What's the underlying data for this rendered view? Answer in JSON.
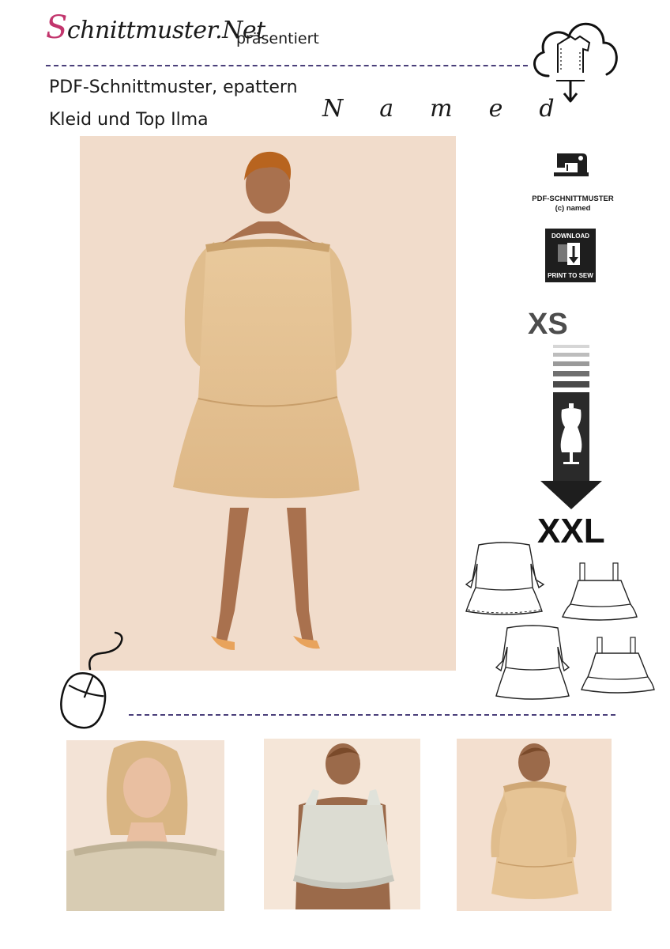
{
  "header": {
    "logo_text": "chnittmuster.Net",
    "logo_initial": "S",
    "presents": "präsentiert"
  },
  "title": {
    "line1": "PDF-Schnittmuster, epattern",
    "line2": "Kleid und Top Ilma",
    "brand": "Named"
  },
  "sidebar": {
    "pattern_label_line1": "PDF-SCHNITTMUSTER",
    "pattern_label_line2": "(c) named",
    "download_top": "DOWNLOAD",
    "download_bottom": "PRINT TO SEW",
    "size_min": "XS",
    "size_max": "XXL"
  },
  "icons": {
    "cloud": "cloud-download-icon",
    "sewing_machine": "sewing-machine-icon",
    "mouse": "mouse-icon",
    "dress_form": "dress-form-icon"
  },
  "colors": {
    "accent": "#c2356d",
    "dash": "#4a3f7a",
    "fabric_main": "#e6c495",
    "fabric_top": "#dcdcd2",
    "photo_bg": "#f0dac8"
  }
}
